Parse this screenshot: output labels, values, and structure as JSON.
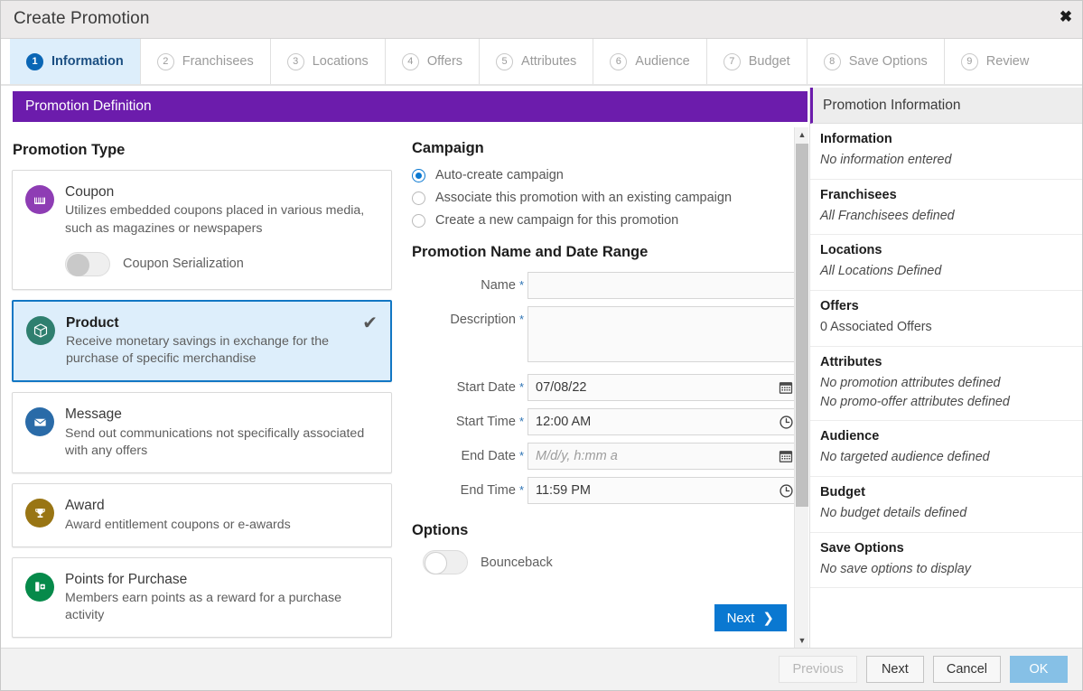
{
  "window": {
    "title": "Create Promotion",
    "close_icon": "close-icon"
  },
  "tabs": [
    {
      "num": "1",
      "label": "Information",
      "active": true
    },
    {
      "num": "2",
      "label": "Franchisees",
      "active": false
    },
    {
      "num": "3",
      "label": "Locations",
      "active": false
    },
    {
      "num": "4",
      "label": "Offers",
      "active": false
    },
    {
      "num": "5",
      "label": "Attributes",
      "active": false
    },
    {
      "num": "6",
      "label": "Audience",
      "active": false
    },
    {
      "num": "7",
      "label": "Budget",
      "active": false
    },
    {
      "num": "8",
      "label": "Save Options",
      "active": false
    },
    {
      "num": "9",
      "label": "Review",
      "active": false
    }
  ],
  "section": {
    "header": "Promotion Definition",
    "header_color": "#6c1cac"
  },
  "promotion_type": {
    "title": "Promotion Type",
    "cards": [
      {
        "name": "Coupon",
        "desc": "Utilizes embedded coupons placed in various media, such as magazines or newspapers",
        "icon": "coupon-icon",
        "icon_color": "#8e3db4",
        "selected": false,
        "toggle": {
          "label": "Coupon Serialization",
          "on": false
        }
      },
      {
        "name": "Product",
        "desc": "Receive monetary savings in exchange for the purchase of specific merchandise",
        "icon": "cube-icon",
        "icon_color": "#2f7f6f",
        "selected": true,
        "check": "✔"
      },
      {
        "name": "Message",
        "desc": "Send out communications not specifically associated with any offers",
        "icon": "envelope-icon",
        "icon_color": "#2a6ba8",
        "selected": false
      },
      {
        "name": "Award",
        "desc": "Award entitlement coupons or e-awards",
        "icon": "trophy-icon",
        "icon_color": "#997514",
        "selected": false
      },
      {
        "name": "Points for Purchase",
        "desc": "Members earn points as a reward for a purchase activity",
        "icon": "points-icon",
        "icon_color": "#068a4a",
        "selected": false
      }
    ]
  },
  "campaign": {
    "title": "Campaign",
    "options": [
      {
        "label": "Auto-create campaign",
        "checked": true
      },
      {
        "label": "Associate this promotion with an existing campaign",
        "checked": false
      },
      {
        "label": "Create a new campaign for this promotion",
        "checked": false
      }
    ]
  },
  "name_date": {
    "title": "Promotion Name and Date Range",
    "fields": [
      {
        "label": "Name",
        "required": "*",
        "value": "",
        "placeholder": "",
        "icon": ""
      },
      {
        "label": "Description",
        "required": "*",
        "value": "",
        "placeholder": "",
        "icon": "",
        "multiline": true
      },
      {
        "label": "Start Date",
        "required": "*",
        "value": "07/08/22",
        "placeholder": "",
        "icon": "calendar-icon"
      },
      {
        "label": "Start Time",
        "required": "*",
        "value": "12:00 AM",
        "placeholder": "",
        "icon": "clock-icon"
      },
      {
        "label": "End Date",
        "required": "*",
        "value": "",
        "placeholder": "M/d/y, h:mm a",
        "icon": "calendar-icon"
      },
      {
        "label": "End Time",
        "required": "*",
        "value": "11:59 PM",
        "placeholder": "",
        "icon": "clock-icon"
      }
    ]
  },
  "options_section": {
    "title": "Options",
    "toggle": {
      "label": "Bounceback",
      "on": false
    }
  },
  "next_step_button": {
    "label": "Next",
    "icon": "chevron-right-icon",
    "color": "#0a78d1"
  },
  "summary": {
    "header": "Promotion Information",
    "items": [
      {
        "title": "Information",
        "value": "No information entered",
        "italic": true
      },
      {
        "title": "Franchisees",
        "value": "All Franchisees defined",
        "italic": true
      },
      {
        "title": "Locations",
        "value": "All Locations Defined",
        "italic": true
      },
      {
        "title": "Offers",
        "value": "0 Associated Offers",
        "italic": false
      },
      {
        "title": "Attributes",
        "value": "No promotion attributes defined",
        "value2": "No promo-offer attributes defined",
        "italic": true
      },
      {
        "title": "Audience",
        "value": "No targeted audience defined",
        "italic": true
      },
      {
        "title": "Budget",
        "value": "No budget details defined",
        "italic": true
      },
      {
        "title": "Save Options",
        "value": "No save options to display",
        "italic": true
      }
    ]
  },
  "footer": {
    "previous": "Previous",
    "next": "Next",
    "cancel": "Cancel",
    "ok": "OK"
  },
  "scrollbar": {
    "up_icon": "triangle-up-icon",
    "down_icon": "triangle-down-icon"
  }
}
